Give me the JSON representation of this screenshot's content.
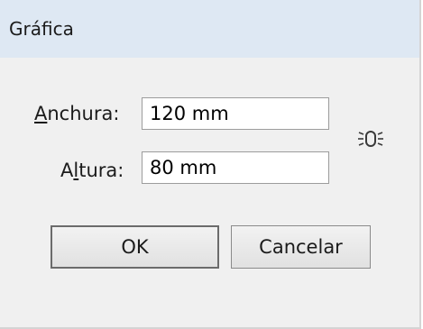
{
  "dialog": {
    "title": "Gráfica"
  },
  "fields": {
    "width": {
      "label_mnemonic": "A",
      "label_rest": "nchura:",
      "value": "120 mm"
    },
    "height": {
      "label_pre": "A",
      "label_mnemonic": "l",
      "label_rest": "tura:",
      "value": "80 mm"
    }
  },
  "buttons": {
    "ok_label": "OK",
    "cancel_label": "Cancelar"
  },
  "icons": {
    "constrain": "link-proportions-icon"
  },
  "colors": {
    "titlebar": "#dee8f3",
    "background": "#f0f0f0"
  }
}
